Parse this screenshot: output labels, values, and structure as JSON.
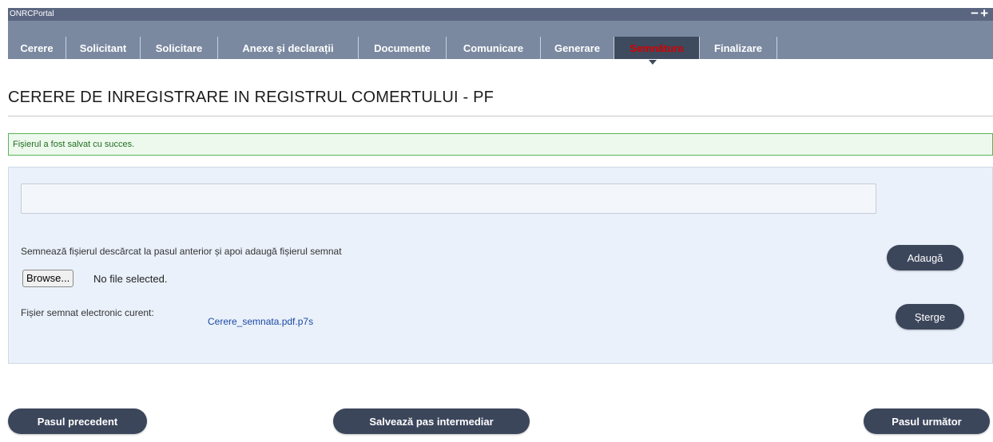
{
  "portal": {
    "title": "ONRCPortal",
    "controls": "−+"
  },
  "tabs": [
    {
      "label": "Cerere"
    },
    {
      "label": "Solicitant"
    },
    {
      "label": "Solicitare"
    },
    {
      "label": "Anexe și declarații"
    },
    {
      "label": "Documente"
    },
    {
      "label": "Comunicare"
    },
    {
      "label": "Generare"
    },
    {
      "label": "Semnătura",
      "active": true
    },
    {
      "label": "Finalizare"
    }
  ],
  "page": {
    "title": "CERERE DE INREGISTRARE IN REGISTRUL COMERTULUI - PF"
  },
  "notice": {
    "success": "Fișierul a fost salvat cu succes."
  },
  "upload": {
    "field_value": "",
    "instruction": "Semnează fișierul descărcat la pasul anterior și apoi adaugă fișierul semnat",
    "browse_label": "Browse...",
    "no_file_text": "No file selected.",
    "add_label": "Adaugă",
    "signed_label": "Fișier semnat electronic curent:",
    "signed_file": "Cerere_semnata.pdf.p7s",
    "delete_label": "Șterge"
  },
  "footer": {
    "prev_label": "Pasul precedent",
    "save_label": "Salvează pas intermediar",
    "next_label": "Pasul următor"
  },
  "colors": {
    "header": "#5a6680",
    "tabbar": "#7a89a0",
    "active_tab": "#3e4a5d",
    "active_tab_text": "#d40000",
    "button": "#3c465b",
    "success_border": "#59b559",
    "panel": "#eaf1fb"
  }
}
